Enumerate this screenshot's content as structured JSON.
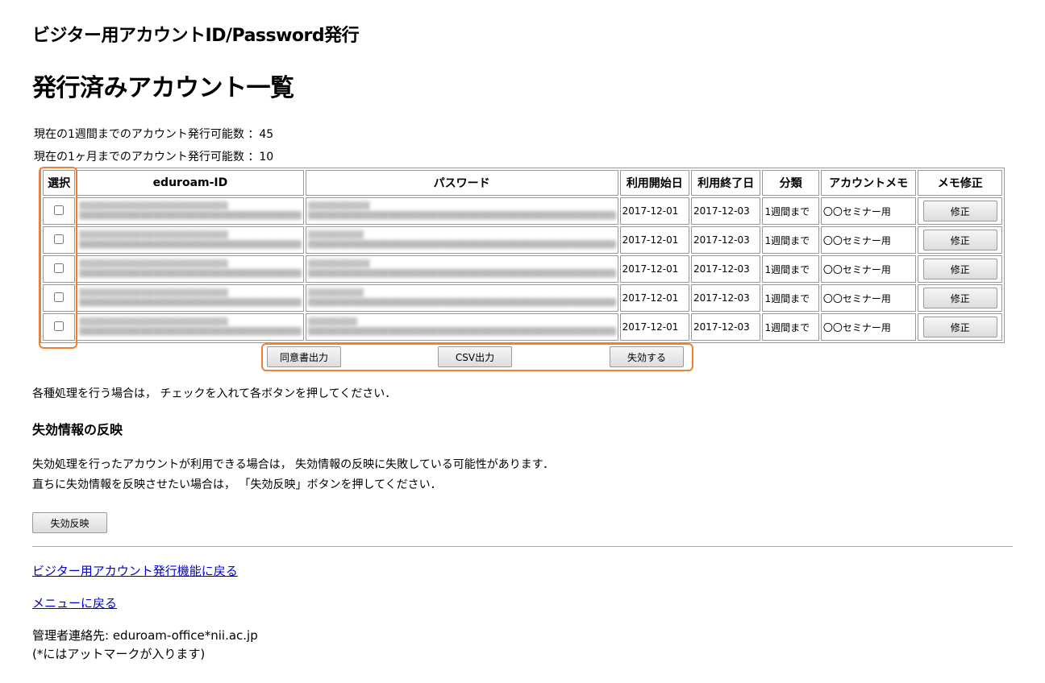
{
  "header": {
    "page_title": "ビジター用アカウントID/Password発行",
    "section_title": "発行済みアカウント一覧"
  },
  "info": {
    "week_limit": "現在の1週間までのアカウント発行可能数 ：45",
    "month_limit": "現在の1ヶ月までのアカウント発行可能数 ：10"
  },
  "table": {
    "headers": [
      "選択",
      "eduroam-ID",
      "パスワード",
      "利用開始日",
      "利用終了日",
      "分類",
      "アカウントメモ",
      "メモ修正"
    ],
    "rows": [
      {
        "start": "2017-12-01",
        "end": "2017-12-03",
        "class": "1週間まで",
        "memo": "〇〇セミナー用",
        "edit_label": "修正"
      },
      {
        "start": "2017-12-01",
        "end": "2017-12-03",
        "class": "1週間まで",
        "memo": "〇〇セミナー用",
        "edit_label": "修正"
      },
      {
        "start": "2017-12-01",
        "end": "2017-12-03",
        "class": "1週間まで",
        "memo": "〇〇セミナー用",
        "edit_label": "修正"
      },
      {
        "start": "2017-12-01",
        "end": "2017-12-03",
        "class": "1週間まで",
        "memo": "〇〇セミナー用",
        "edit_label": "修正"
      },
      {
        "start": "2017-12-01",
        "end": "2017-12-03",
        "class": "1週間まで",
        "memo": "〇〇セミナー用",
        "edit_label": "修正"
      }
    ]
  },
  "actions": {
    "consent_label": "同意書出力",
    "csv_label": "CSV出力",
    "disable_label": "失効する"
  },
  "note": "各種処理を行う場合は， チェックを入れて各ボタンを押してください．",
  "revocation": {
    "title": "失効情報の反映",
    "line1": "失効処理を行ったアカウントが利用できる場合は， 失効情報の反映に失敗している可能性があります．",
    "line2": "直ちに失効情報を反映させたい場合は， 「失効反映」ボタンを押してください．",
    "button_label": "失効反映"
  },
  "links": {
    "visitor": "ビジター用アカウント発行機能に戻る",
    "menu": "メニューに戻る"
  },
  "contact": {
    "line1": "管理者連絡先: eduroam-office*nii.ac.jp",
    "line2": "(*にはアットマークが入ります)"
  },
  "colors": {
    "highlight": "#f08030",
    "link": "#0000cc"
  }
}
